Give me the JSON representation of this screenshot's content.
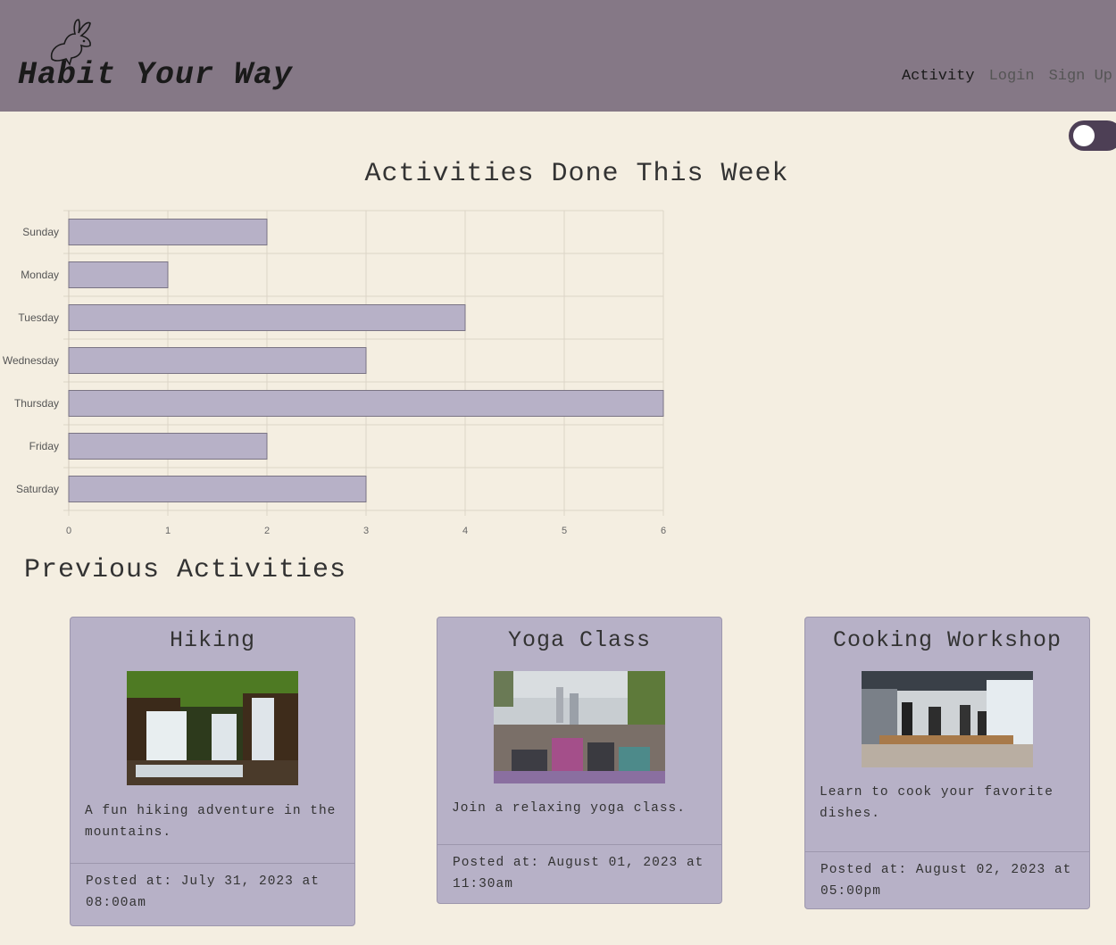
{
  "header": {
    "brand": "Habit Your Way",
    "nav": [
      "Activity",
      "Login",
      "Sign Up"
    ]
  },
  "colors": {
    "header_bg": "#857886",
    "page_bg": "#f4eee1",
    "bar_fill": "#b7b1c7",
    "card_bg": "#b7b1c7",
    "toggle_bg": "#4d3f55"
  },
  "chart_title": "Activities Done This Week",
  "chart_data": {
    "type": "bar",
    "orientation": "horizontal",
    "categories": [
      "Sunday",
      "Monday",
      "Tuesday",
      "Wednesday",
      "Thursday",
      "Friday",
      "Saturday"
    ],
    "values": [
      2,
      1,
      4,
      3,
      6,
      2,
      3
    ],
    "xlim": [
      0,
      6
    ],
    "xticks": [
      "0",
      "1",
      "2",
      "3",
      "4",
      "5",
      "6"
    ],
    "grid": true,
    "legend": "none"
  },
  "previous_title": "Previous Activities",
  "activities": [
    {
      "title": "Hiking",
      "description": "A fun hiking adventure in the mountains.",
      "posted": "Posted at: July 31, 2023 at 08:00am"
    },
    {
      "title": "Yoga Class",
      "description": "Join a relaxing yoga class.",
      "posted": "Posted at: August 01, 2023 at 11:30am"
    },
    {
      "title": "Cooking Workshop",
      "description": "Learn to cook your favorite dishes.",
      "posted": "Posted at: August 02, 2023 at 05:00pm"
    }
  ]
}
